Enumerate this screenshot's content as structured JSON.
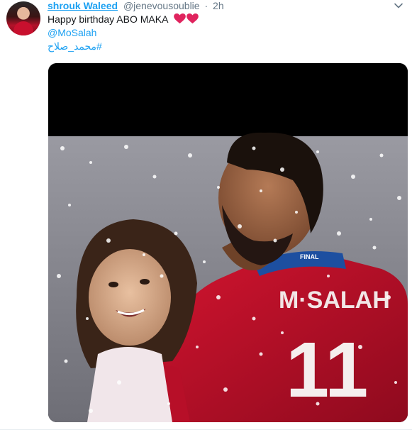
{
  "tweet": {
    "author_name": "shrouk Waleed",
    "author_handle": "@jenevousoublie",
    "separator": "·",
    "timestamp": "2h",
    "text_line1": "Happy birthday ABO MAKA",
    "emoji": [
      "red-heart",
      "red-heart"
    ],
    "mention": "@MoSalah",
    "hashtag": "#محمد_صلاح"
  },
  "media": {
    "jersey_name": "M·SALAH",
    "jersey_number": "11",
    "collar_text": "FINAL",
    "colors": {
      "shirt": "#c8102e",
      "background_top": "#000000",
      "background": "#8a8a90"
    }
  },
  "colors": {
    "link": "#1da1f2",
    "secondary": "#657786",
    "heart": "#e0245e"
  }
}
